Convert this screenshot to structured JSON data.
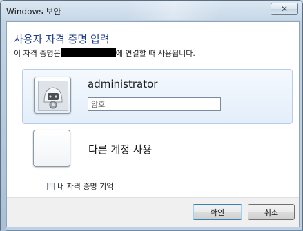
{
  "window": {
    "title": "Windows 보안",
    "close_glyph": "✕"
  },
  "dialog": {
    "heading": "사용자 자격 증명 입력",
    "subtext_before": "이 자격 증명은",
    "subtext_after": "에 연결할 때 사용됩니다."
  },
  "credential": {
    "username": "administrator",
    "password_placeholder": "암호",
    "avatar_icon": "user-avatar-icon"
  },
  "other_account": {
    "label": "다른 계정 사용"
  },
  "remember": {
    "label": "내 자격 증명 기억",
    "checked": false
  },
  "buttons": {
    "ok": "확인",
    "cancel": "취소"
  }
}
